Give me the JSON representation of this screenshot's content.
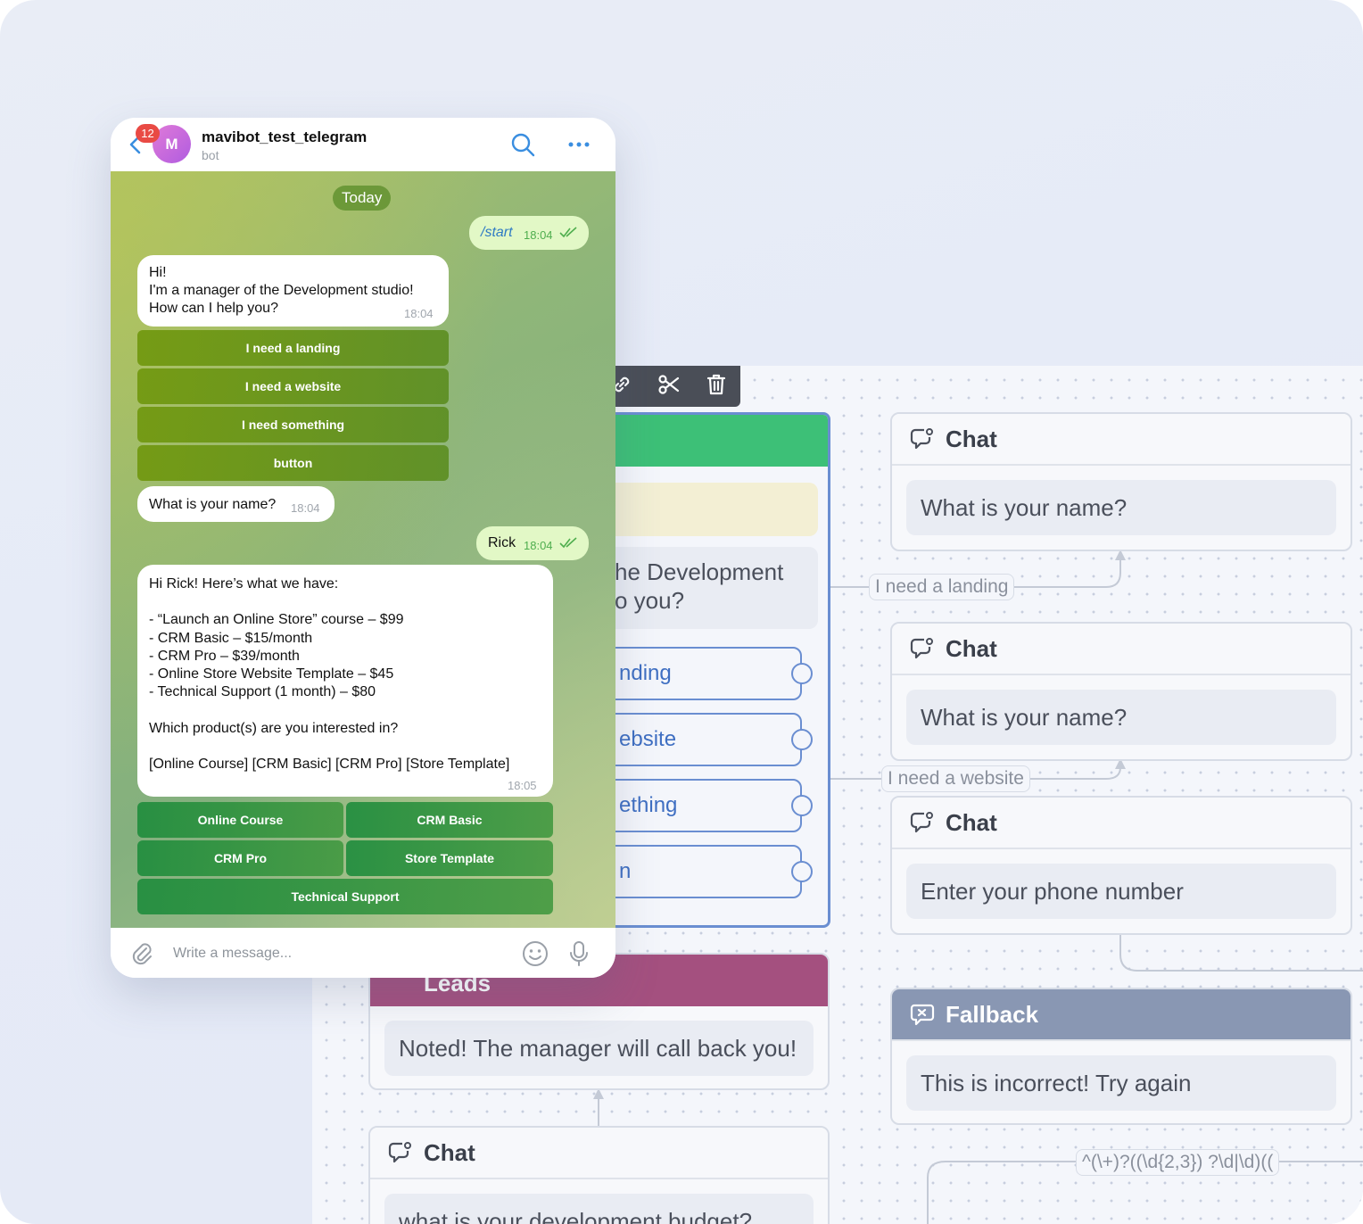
{
  "telegram": {
    "badge_count": "12",
    "avatar_letter": "M",
    "bot_name": "mavibot_test_telegram",
    "bot_subtitle": "bot",
    "day_label": "Today",
    "messages": {
      "start_text": "/start",
      "start_time": "18:04",
      "greeting_lines": [
        "Hi!",
        "I'm a manager of the Development studio!",
        "How can I help you?"
      ],
      "greeting_time": "18:04",
      "name_question": "What is your name?",
      "name_question_time": "18:04",
      "reply_name": "Rick",
      "reply_name_time": "18:04",
      "products_lines": [
        "Hi Rick! Here’s what we have:",
        "",
        "- “Launch an Online Store” course – $99",
        "- CRM Basic – $15/month",
        "- CRM Pro – $39/month",
        "- Online Store Website Template – $45",
        "- Technical Support (1 month) – $80",
        "",
        "Which product(s) are you interested in?",
        "",
        "[Online Course] [CRM Basic] [CRM Pro] [Store Template]"
      ],
      "products_time": "18:05"
    },
    "keyboard1": [
      "I need a landing",
      "I need a website",
      "I need something",
      "button"
    ],
    "keyboard2": {
      "online_course": "Online Course",
      "crm_basic": "CRM Basic",
      "crm_pro": "CRM Pro",
      "store_template": "Store Template",
      "technical_support": "Technical Support"
    },
    "input_placeholder": "Write a message..."
  },
  "canvas": {
    "toolbar": [
      "link-icon",
      "scissors-icon",
      "trash-icon"
    ],
    "start_node": {
      "message_lines": [
        "he Development",
        "o you?"
      ],
      "buttons": [
        "nding",
        "ebsite",
        "ething",
        "n"
      ]
    },
    "chat_nodes": [
      {
        "title": "Chat",
        "text": "What is your name?"
      },
      {
        "title": "Chat",
        "text": "What is your name?"
      },
      {
        "title": "Chat",
        "text": "Enter your phone number"
      }
    ],
    "edge_labels": [
      "I need a landing",
      "I need a website",
      "^(\\+)?((\\d{2,3}) ?\\d|\\d)(("
    ],
    "leads_node": {
      "title": "Leads",
      "text": "Noted! The manager will call back you!"
    },
    "fallback_node": {
      "title": "Fallback",
      "text": "This is incorrect! Try again"
    },
    "budget_node": {
      "title": "Chat",
      "text": "what is your development budget?"
    }
  },
  "colors": {
    "start_header": "#3dc077",
    "leads_header": "#a4507f",
    "fallback_header": "#8997b3",
    "accent_blue": "#6a8ed1"
  }
}
